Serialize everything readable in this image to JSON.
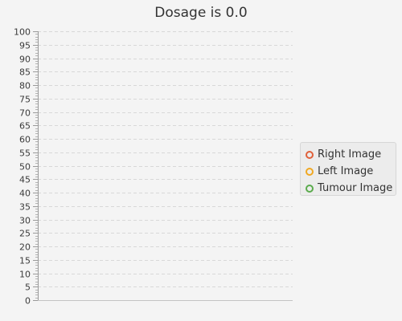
{
  "chart_data": {
    "type": "scatter",
    "title": "Dosage is 0.0",
    "xlabel": "",
    "ylabel": "",
    "ylim": [
      0,
      100
    ],
    "y_ticks": [
      0,
      5,
      10,
      15,
      20,
      25,
      30,
      35,
      40,
      45,
      50,
      55,
      60,
      65,
      70,
      75,
      80,
      85,
      90,
      95,
      100
    ],
    "y_minor_step": 1,
    "grid": true,
    "legend_position": "right",
    "series": [
      {
        "name": "Right Image",
        "color": "#e0603a",
        "points": []
      },
      {
        "name": "Left Image",
        "color": "#f0a822",
        "points": []
      },
      {
        "name": "Tumour Image",
        "color": "#5aab4c",
        "points": []
      }
    ]
  }
}
